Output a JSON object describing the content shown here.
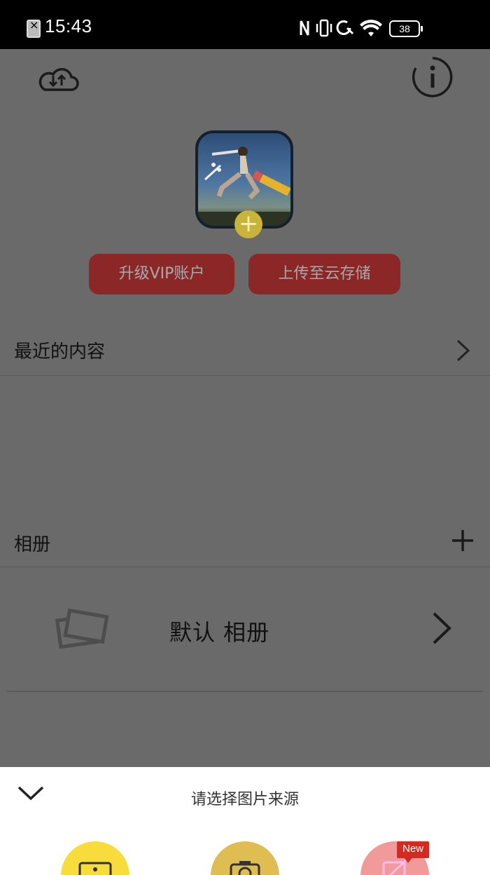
{
  "status_bar": {
    "time": "15:43",
    "battery": "38"
  },
  "top_bar": {
    "cloud_icon": "cloud-sync-icon",
    "info_icon": "info-icon"
  },
  "actions": {
    "vip_label": "升级VIP账户",
    "upload_label": "上传至云存储"
  },
  "recent": {
    "title": "最近的内容"
  },
  "albums": {
    "title": "相册",
    "items": [
      {
        "name": "默认 相册"
      }
    ]
  },
  "sheet": {
    "title": "请选择图片来源",
    "sources": [
      "gallery-icon",
      "camera-icon",
      "other-source-icon"
    ],
    "new_badge": "New"
  },
  "colors": {
    "accent_red": "#8b2727",
    "sheet_yellow": "#f7dc3c",
    "badge_red": "#d42a1f"
  }
}
